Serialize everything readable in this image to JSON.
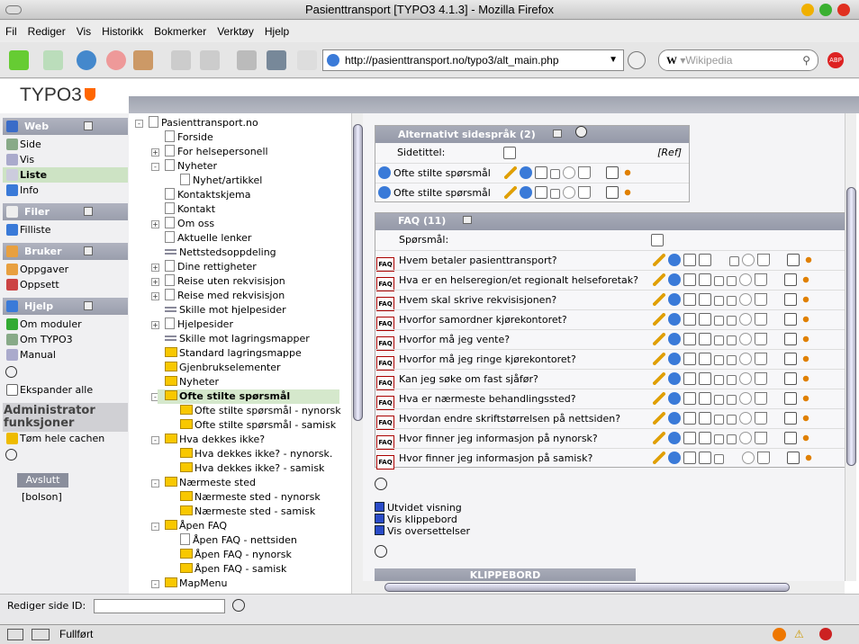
{
  "window": {
    "title": "Pasienttransport [TYPO3 4.1.3] - Mozilla Firefox"
  },
  "menu": [
    "Fil",
    "Rediger",
    "Vis",
    "Historikk",
    "Bokmerker",
    "Verktøy",
    "Hjelp"
  ],
  "toolbar": {
    "url": "http://pasienttransport.no/typo3/alt_main.php",
    "search_placeholder": "Wikipedia",
    "search_engine": "W"
  },
  "logo": "TYPO3",
  "leftnav": {
    "sections": [
      {
        "label": "Web",
        "items": [
          "Side",
          "Vis",
          "Liste",
          "Info"
        ],
        "active": "Liste"
      },
      {
        "label": "Filer",
        "items": [
          "Filliste"
        ]
      },
      {
        "label": "Bruker",
        "items": [
          "Oppgaver",
          "Oppsett"
        ]
      },
      {
        "label": "Hjelp",
        "items": [
          "Om moduler",
          "Om TYPO3",
          "Manual"
        ]
      }
    ],
    "expand_all": "Ekspander alle",
    "admin_title": "Administrator funksjoner",
    "clear_cache": "Tøm hele cachen",
    "logout": "Avslutt",
    "username": "[bolson]"
  },
  "tree": [
    {
      "l": 0,
      "t": "Pasienttransport.no",
      "ic": "page",
      "pm": "-"
    },
    {
      "l": 1,
      "t": "Forside",
      "ic": "page"
    },
    {
      "l": 1,
      "t": "For helsepersonell",
      "ic": "page",
      "pm": "+"
    },
    {
      "l": 1,
      "t": "Nyheter",
      "ic": "page",
      "pm": "-"
    },
    {
      "l": 2,
      "t": "Nyhet/artikkel",
      "ic": "page"
    },
    {
      "l": 1,
      "t": "Kontaktskjema",
      "ic": "page"
    },
    {
      "l": 1,
      "t": "Kontakt",
      "ic": "page"
    },
    {
      "l": 1,
      "t": "Om oss",
      "ic": "page",
      "pm": "+"
    },
    {
      "l": 1,
      "t": "Aktuelle lenker",
      "ic": "page"
    },
    {
      "l": 1,
      "t": "Nettstedsoppdeling",
      "ic": "sep"
    },
    {
      "l": 1,
      "t": "Dine rettigheter",
      "ic": "page",
      "pm": "+"
    },
    {
      "l": 1,
      "t": "Reise uten rekvisisjon",
      "ic": "page",
      "pm": "+"
    },
    {
      "l": 1,
      "t": "Reise med rekvisisjon",
      "ic": "page",
      "pm": "+"
    },
    {
      "l": 1,
      "t": "Skille mot hjelpesider",
      "ic": "sep"
    },
    {
      "l": 1,
      "t": "Hjelpesider",
      "ic": "page",
      "pm": "+"
    },
    {
      "l": 1,
      "t": "Skille mot lagringsmapper",
      "ic": "sep"
    },
    {
      "l": 1,
      "t": "Standard lagringsmappe",
      "ic": "folder"
    },
    {
      "l": 1,
      "t": "Gjenbrukselementer",
      "ic": "folder"
    },
    {
      "l": 1,
      "t": "Nyheter",
      "ic": "folder"
    },
    {
      "l": 1,
      "t": "Ofte stilte spørsmål",
      "ic": "folder",
      "pm": "-",
      "sel": true
    },
    {
      "l": 2,
      "t": "Ofte stilte spørsmål - nynorsk",
      "ic": "folder"
    },
    {
      "l": 2,
      "t": "Ofte stilte spørsmål - samisk",
      "ic": "folder"
    },
    {
      "l": 1,
      "t": "Hva dekkes ikke?",
      "ic": "folder",
      "pm": "-"
    },
    {
      "l": 2,
      "t": "Hva dekkes ikke? - nynorsk.",
      "ic": "folder"
    },
    {
      "l": 2,
      "t": "Hva dekkes ikke? - samisk",
      "ic": "folder"
    },
    {
      "l": 1,
      "t": "Nærmeste sted",
      "ic": "folder",
      "pm": "-"
    },
    {
      "l": 2,
      "t": "Nærmeste sted - nynorsk",
      "ic": "folder"
    },
    {
      "l": 2,
      "t": "Nærmeste sted - samisk",
      "ic": "folder"
    },
    {
      "l": 1,
      "t": "Åpen FAQ",
      "ic": "folder",
      "pm": "-"
    },
    {
      "l": 2,
      "t": "Åpen FAQ - nettsiden",
      "ic": "page"
    },
    {
      "l": 2,
      "t": "Åpen FAQ - nynorsk",
      "ic": "folder"
    },
    {
      "l": 2,
      "t": "Åpen FAQ - samisk",
      "ic": "folder"
    },
    {
      "l": 1,
      "t": "MapMenu",
      "ic": "folder",
      "pm": "-"
    }
  ],
  "alt_lang": {
    "title": "Alternativt sidespråk (2)",
    "col": "Sidetittel:",
    "ref": "[Ref]",
    "rows": [
      "Ofte stilte spørsmål",
      "Ofte stilte spørsmål"
    ]
  },
  "faq": {
    "title": "FAQ (11)",
    "col": "Spørsmål:",
    "icon_label": "FAQ",
    "rows": [
      "Hvem betaler pasienttransport?",
      "Hva er en helseregion/et regionalt helseforetak?",
      "Hvem skal skrive rekvisisjonen?",
      "Hvorfor samordner kjørekontoret?",
      "Hvorfor må jeg vente?",
      "Hvorfor må jeg ringe kjørekontoret?",
      "Kan jeg søke om fast sjåfør?",
      "Hva er nærmeste behandlingssted?",
      "Hvordan endre skriftstørrelsen på nettsiden?",
      "Hvor finner jeg informasjon på nynorsk?",
      "Hvor finner jeg informasjon på samisk?"
    ]
  },
  "options": [
    {
      "label": "Utvidet visning",
      "checked": true
    },
    {
      "label": "Vis klippebord",
      "checked": true
    },
    {
      "label": "Vis oversettelser",
      "checked": true
    }
  ],
  "clipboard": "KLIPPEBORD",
  "edit_page_id": {
    "label": "Rediger side ID:",
    "value": ""
  },
  "status": "Fullført"
}
